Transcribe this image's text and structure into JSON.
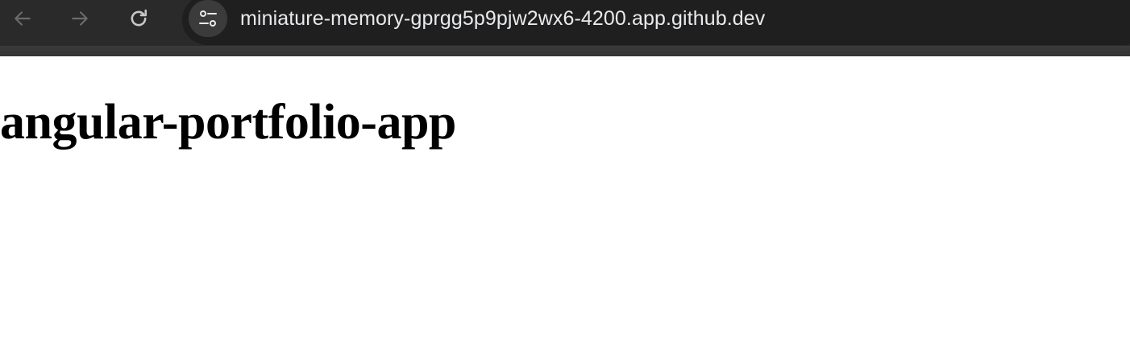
{
  "browser": {
    "url": "miniature-memory-gprgg5p9pjw2wx6-4200.app.github.dev",
    "toolbar_color": "#2a2a2a",
    "omnibox_color": "#1f1f1f",
    "icons": {
      "back": "back-arrow-icon",
      "forward": "forward-arrow-icon",
      "reload": "reload-icon",
      "site_info": "tune-icon"
    }
  },
  "page": {
    "heading": "angular-portfolio-app",
    "background": "#ffffff"
  }
}
